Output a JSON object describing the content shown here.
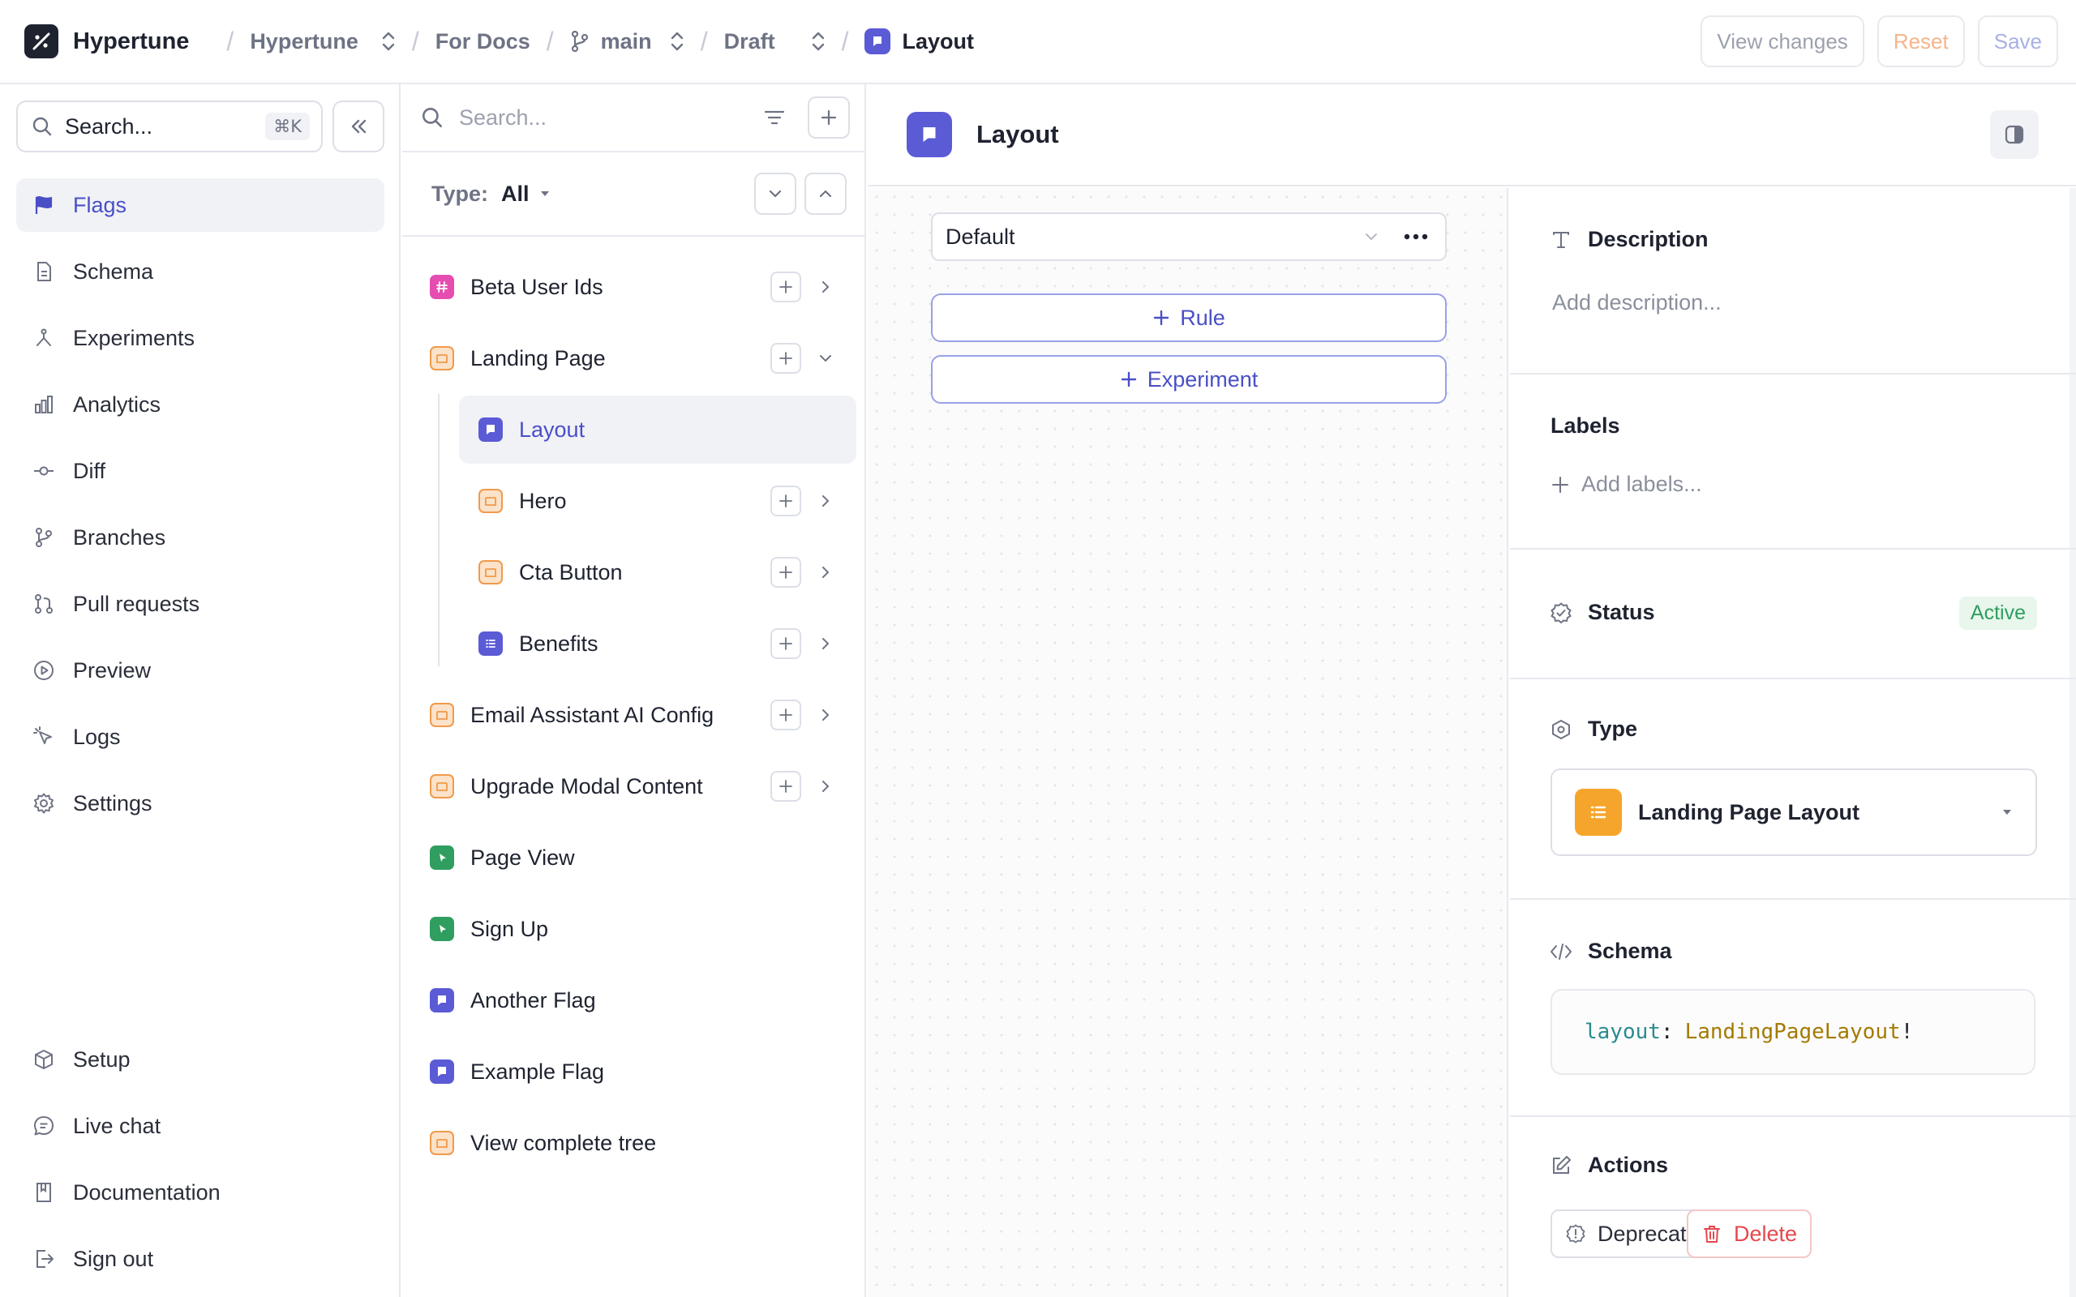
{
  "topbar": {
    "brand": "Hypertune",
    "breadcrumbs": [
      "Hypertune",
      "For Docs",
      "main",
      "Draft",
      "Layout"
    ],
    "actions": {
      "view_changes": "View changes",
      "reset": "Reset",
      "save": "Save"
    }
  },
  "sidebar": {
    "search_placeholder": "Search...",
    "shortcut": "⌘K",
    "items": [
      {
        "label": "Flags",
        "icon": "flag-icon",
        "active": true
      },
      {
        "label": "Schema",
        "icon": "document-icon"
      },
      {
        "label": "Experiments",
        "icon": "experiment-icon"
      },
      {
        "label": "Analytics",
        "icon": "bar-chart-icon"
      },
      {
        "label": "Diff",
        "icon": "commit-icon"
      },
      {
        "label": "Branches",
        "icon": "branch-icon"
      },
      {
        "label": "Pull requests",
        "icon": "pull-request-icon"
      },
      {
        "label": "Preview",
        "icon": "play-icon"
      },
      {
        "label": "Logs",
        "icon": "pointer-icon"
      },
      {
        "label": "Settings",
        "icon": "gear-icon"
      }
    ],
    "bottom_items": [
      {
        "label": "Setup",
        "icon": "box-icon"
      },
      {
        "label": "Live chat",
        "icon": "chat-icon"
      },
      {
        "label": "Documentation",
        "icon": "book-icon"
      },
      {
        "label": "Sign out",
        "icon": "sign-out-icon"
      }
    ]
  },
  "tree": {
    "search_placeholder": "Search...",
    "type_label": "Type:",
    "type_value": "All",
    "rows": [
      {
        "label": "Beta User Ids"
      },
      {
        "label": "Landing Page"
      },
      {
        "label": "Layout"
      },
      {
        "label": "Hero"
      },
      {
        "label": "Cta Button"
      },
      {
        "label": "Benefits"
      },
      {
        "label": "Email Assistant AI Config"
      },
      {
        "label": "Upgrade Modal Content"
      },
      {
        "label": "Page View"
      },
      {
        "label": "Sign Up"
      },
      {
        "label": "Another Flag"
      },
      {
        "label": "Example Flag"
      },
      {
        "label": "View complete tree"
      }
    ]
  },
  "main": {
    "title": "Layout",
    "default_label": "Default",
    "rule_button": "Rule",
    "experiment_button": "Experiment"
  },
  "detail": {
    "description_title": "Description",
    "description_placeholder": "Add description...",
    "labels_title": "Labels",
    "labels_placeholder": "Add labels...",
    "status_title": "Status",
    "status_value": "Active",
    "type_title": "Type",
    "type_value": "Landing Page Layout",
    "schema_title": "Schema",
    "schema_key": "layout",
    "schema_colon": ":",
    "schema_type": "LandingPageLayout",
    "schema_bang": "!",
    "actions_title": "Actions",
    "deprecate": "Deprecate",
    "delete": "Delete"
  },
  "colors": {
    "accent": "#5b5bd6",
    "status_green": "#2f9e5f",
    "danger": "#e5484d",
    "folder_orange": "#f09a4a"
  }
}
